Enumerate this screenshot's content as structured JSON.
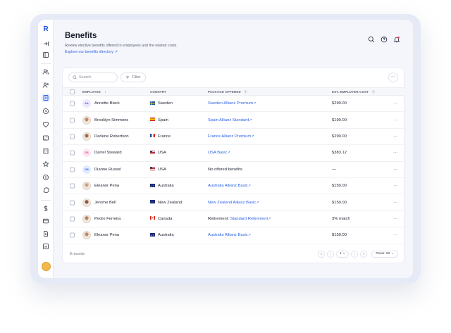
{
  "page": {
    "title": "Benefits",
    "subtitle": "Review elective benefits offered to employees and the related costs.",
    "explore_link": "Explore our benefits directory ↗"
  },
  "header_icons": [
    "search-icon",
    "help-icon",
    "notification-bell-icon"
  ],
  "sidebar": {
    "logo": "R",
    "icons": [
      "collapse-icon",
      "panel-icon",
      "people-icon",
      "add-user-icon",
      "benefits-icon",
      "clock-icon",
      "heart-icon",
      "id-card-icon",
      "building-icon",
      "star-icon",
      "coin-icon",
      "chat-icon",
      "dollar-icon",
      "card-icon",
      "document-icon",
      "report-icon"
    ]
  },
  "toolbar": {
    "search_placeholder": "Search",
    "filter_label": "Filter",
    "more_label": "···"
  },
  "table": {
    "columns": {
      "employee": "EMPLOYEE",
      "sort_indicator": "↑",
      "country": "COUNTRY",
      "package": "PACKAGE OFFERED",
      "cost": "EST. EMPLOYER COST"
    },
    "rows": [
      {
        "name": "Annette Black",
        "initials": "AA",
        "country": "Sweden",
        "package": "Sweden Allianz Premium",
        "package_prefix": "",
        "is_link": true,
        "cost": "$290.00"
      },
      {
        "name": "Brooklyn Simmons",
        "initials": "",
        "country": "Spain",
        "package": "Spain Allianz Standard",
        "package_prefix": "",
        "is_link": true,
        "cost": "$190.00"
      },
      {
        "name": "Darlene Robertson",
        "initials": "",
        "country": "France",
        "package": "France Allianz Premium",
        "package_prefix": "",
        "is_link": true,
        "cost": "$290.00"
      },
      {
        "name": "Darrel Steward",
        "initials": "DS",
        "country": "USA",
        "package": "USA Basic",
        "package_prefix": "",
        "is_link": true,
        "cost": "$383.12"
      },
      {
        "name": "Dianne Russel",
        "initials": "DR",
        "country": "USA",
        "package": "No offered benefits",
        "package_prefix": "",
        "is_link": false,
        "cost": "—"
      },
      {
        "name": "Eleanor Pena",
        "initials": "",
        "country": "Australia",
        "package": "Australia Allianz Basic",
        "package_prefix": "",
        "is_link": true,
        "cost": "$150.00"
      },
      {
        "name": "Jerome Bell",
        "initials": "",
        "country": "New Zealand",
        "package": "New Zealand Allianz Basic",
        "package_prefix": "",
        "is_link": true,
        "cost": "$150.00"
      },
      {
        "name": "Pedro Ferreira",
        "initials": "",
        "country": "Canada",
        "package": "Standard Retirement",
        "package_prefix": "Retirement:",
        "is_link": true,
        "cost": "3% match"
      },
      {
        "name": "Eleanor Pena",
        "initials": "",
        "country": "Australia",
        "package": "Australia Allianz Basic",
        "package_prefix": "",
        "is_link": true,
        "cost": "$150.00"
      }
    ],
    "row_menu": "···"
  },
  "footer": {
    "records": "8 records",
    "page_select": "1 ⌄",
    "rows_select": "Rows: 50 ⌄"
  },
  "colors": {
    "accent": "#2e62e6",
    "background": "#f4f6fb"
  }
}
